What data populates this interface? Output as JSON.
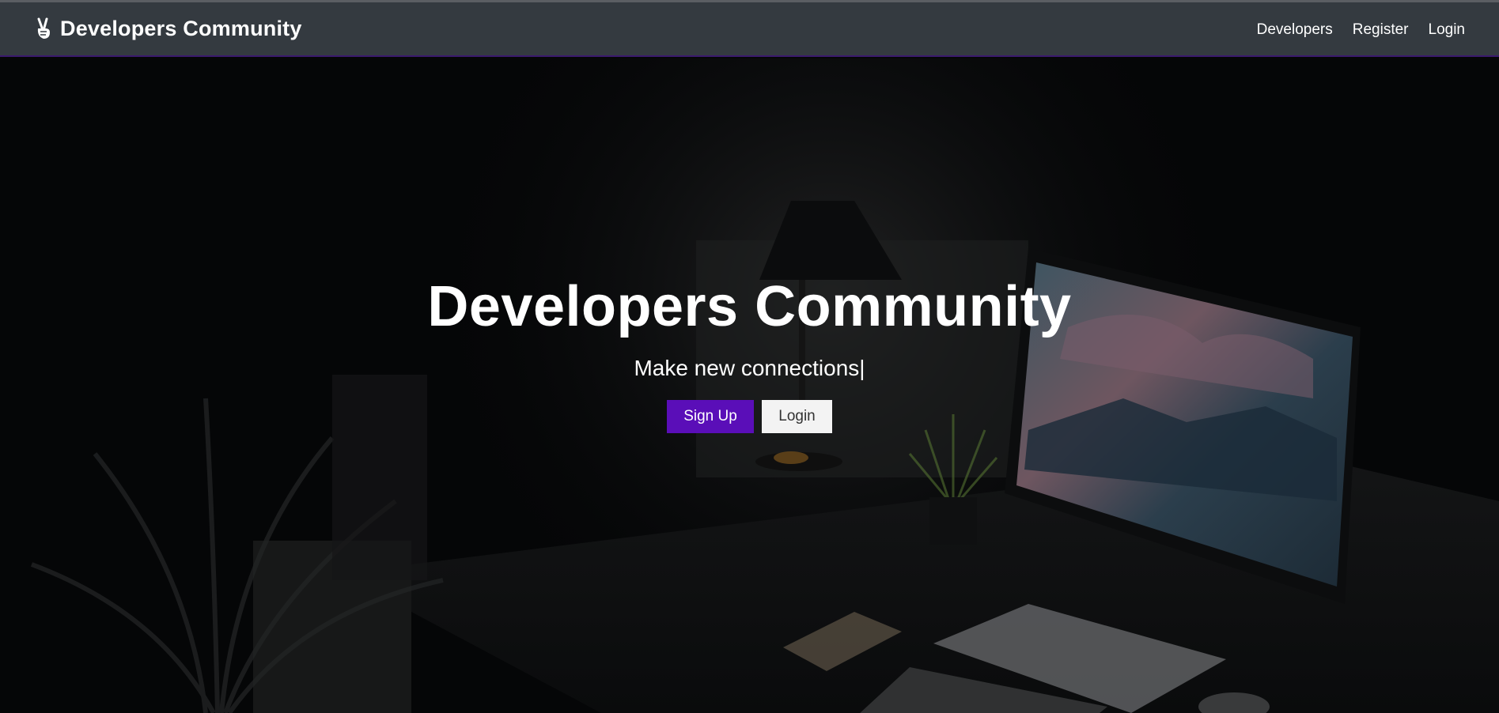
{
  "navbar": {
    "brand_icon": "peace-hand-icon",
    "brand_text": "Developers Community",
    "links": [
      {
        "label": "Developers"
      },
      {
        "label": "Register"
      },
      {
        "label": "Login"
      }
    ]
  },
  "hero": {
    "title": "Developers Community",
    "subtitle": "Make new connections",
    "cursor": "|",
    "buttons": {
      "signup_label": "Sign Up",
      "login_label": "Login"
    },
    "background_description_icon": "desk-setup-photo"
  },
  "colors": {
    "navbar_bg": "#343a40",
    "accent": "#5a0eb8",
    "light_button": "#f3f3f3",
    "hero_overlay": "#050607"
  }
}
